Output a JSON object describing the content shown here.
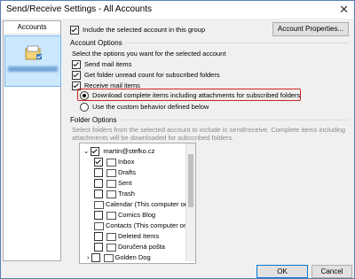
{
  "window": {
    "title": "Send/Receive Settings - All Accounts",
    "close_glyph": "✕"
  },
  "accounts": {
    "header": "Accounts"
  },
  "include_label": "Include the selected account in this group",
  "account_properties_label": "Account Properties...",
  "account_options": {
    "title": "Account Options",
    "subtitle": "Select the options you want for the selected account",
    "send_mail": "Send mail items",
    "get_unread": "Get folder unread count for subscribed folders",
    "receive_mail": "Receive mail items",
    "download_complete": "Download complete items including attachments for subscribed folders",
    "custom_behavior": "Use the custom behavior defined below"
  },
  "folder_options": {
    "title": "Folder Options",
    "description": "Select folders from the selected account to include in send/receive. Complete items including attachments will be downloaded for subscribed folders.",
    "tree": [
      {
        "label": "martin@stefko.cz"
      },
      {
        "label": "Inbox"
      },
      {
        "label": "Drafts"
      },
      {
        "label": "Sent"
      },
      {
        "label": "Trash"
      },
      {
        "label": "Calendar (This computer on"
      },
      {
        "label": "Comics Blog"
      },
      {
        "label": "Contacts (This computer onl"
      },
      {
        "label": "Deleted Items"
      },
      {
        "label": "Doručená pošta"
      },
      {
        "label": "Golden Dog"
      }
    ]
  },
  "ok_label": "OK",
  "cancel_label": "Cancel"
}
